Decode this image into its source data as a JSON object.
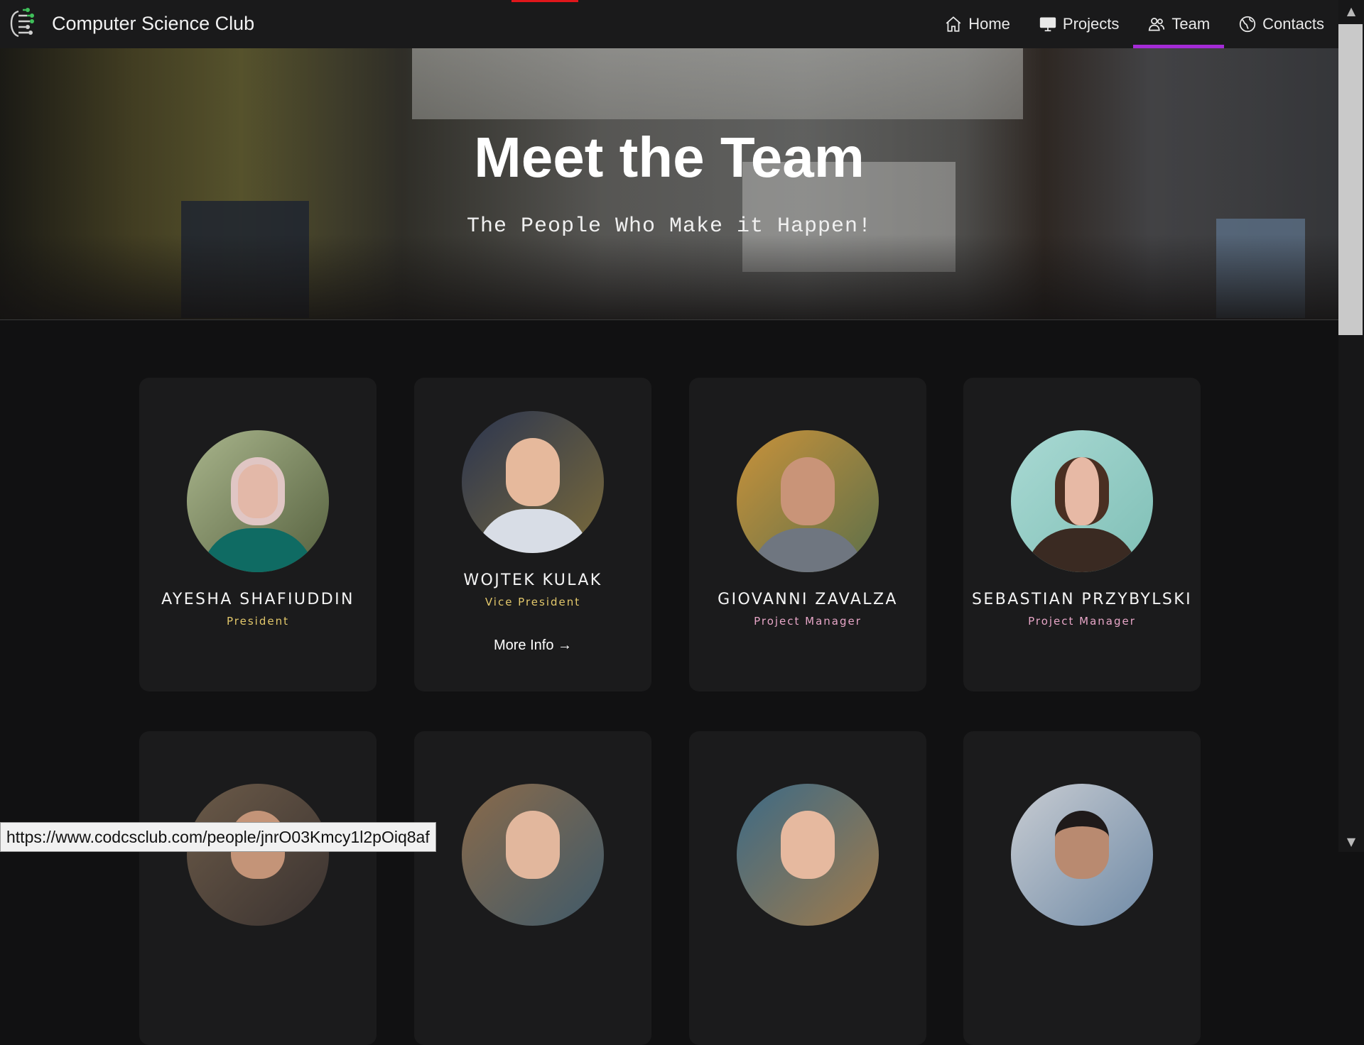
{
  "brand": {
    "name": "Computer Science Club",
    "logo_icon": "circuit-tree-logo"
  },
  "nav": {
    "items": [
      {
        "label": "Home",
        "icon": "home-icon",
        "active": false
      },
      {
        "label": "Projects",
        "icon": "monitor-icon",
        "active": false
      },
      {
        "label": "Team",
        "icon": "users-icon",
        "active": true
      },
      {
        "label": "Contacts",
        "icon": "globe-icon",
        "active": false
      }
    ],
    "active_color": "#a42bd6"
  },
  "hero": {
    "title": "Meet the Team",
    "subtitle": "The People Who Make it Happen!"
  },
  "team": [
    {
      "name": "AYESHA SHAFIUDDIN",
      "role": "President",
      "role_color": "#e3c86b"
    },
    {
      "name": "WOJTEK KULAK",
      "role": "Vice President",
      "role_color": "#e3c86b",
      "more_info": "More Info →"
    },
    {
      "name": "GIOVANNI ZAVALZA",
      "role": "Project Manager",
      "role_color": "#e7a6c7"
    },
    {
      "name": "SEBASTIAN PRZYBYLSKI",
      "role": "Project Manager",
      "role_color": "#e7a6c7"
    }
  ],
  "status_bar": {
    "url": "https://www.codcsclub.com/people/jnrO03Kmcy1l2pOiq8af"
  },
  "colors": {
    "background": "#111112",
    "card": "#1b1b1c",
    "nav": "#1a1a1b",
    "accent_red": "#e0161b"
  }
}
